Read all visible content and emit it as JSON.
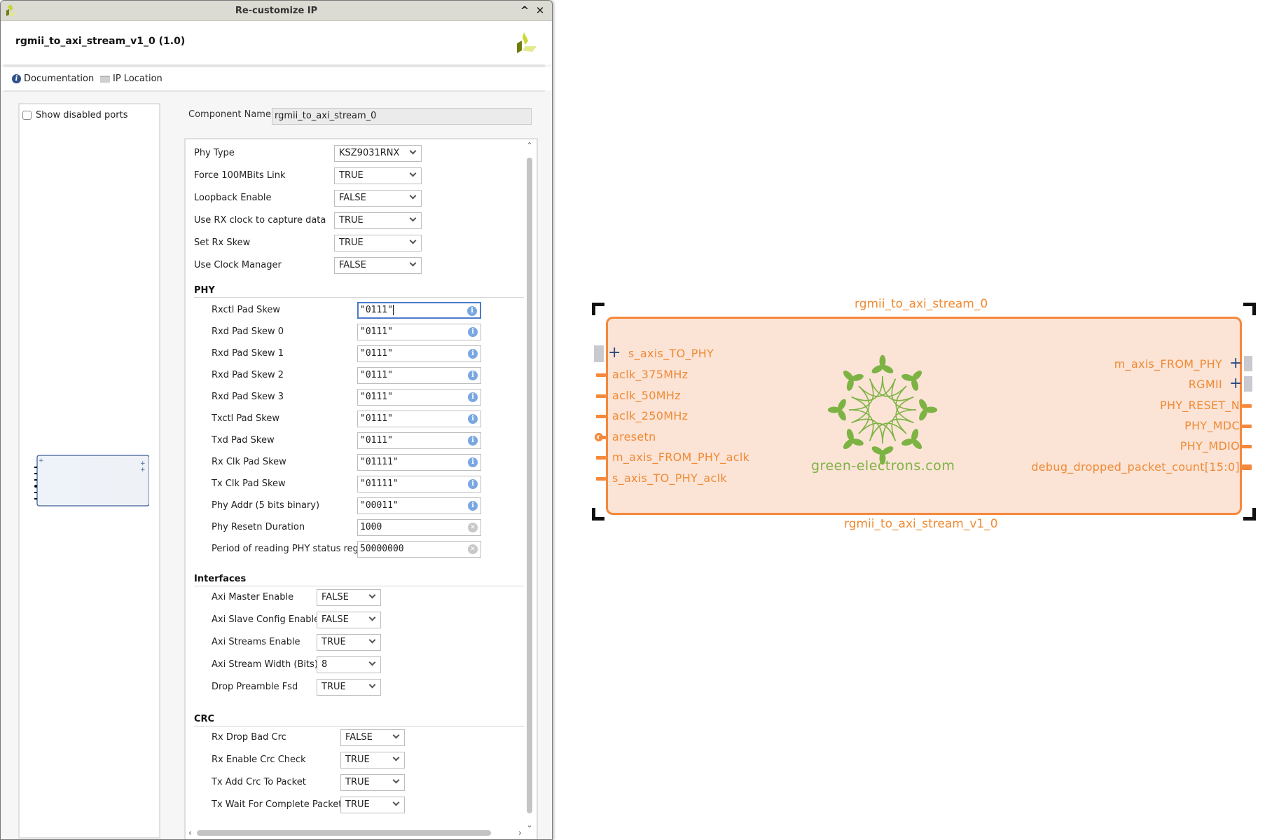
{
  "window": {
    "title": "Re-customize IP",
    "minimize_glyph": "^",
    "close_glyph": "✕"
  },
  "header": {
    "ip_title": "rgmii_to_axi_stream_v1_0 (1.0)",
    "logo_icon": "vendor-logo-icon"
  },
  "links": {
    "documentation": "Documentation",
    "ip_location": "IP Location"
  },
  "left_panel": {
    "show_disabled_ports": "Show disabled ports",
    "show_disabled_ports_checked": false
  },
  "component": {
    "label": "Component Name",
    "value": "rgmii_to_axi_stream_0"
  },
  "params": {
    "general": [
      {
        "label": "Phy Type",
        "value": "KSZ9031RNX"
      },
      {
        "label": "Force 100MBits Link",
        "value": "TRUE"
      },
      {
        "label": "Loopback Enable",
        "value": "FALSE"
      },
      {
        "label": "Use RX clock to capture data",
        "value": "TRUE"
      },
      {
        "label": "Set Rx Skew",
        "value": "TRUE"
      },
      {
        "label": "Use Clock Manager",
        "value": "FALSE"
      }
    ],
    "phy_title": "PHY",
    "phy": [
      {
        "label": "Rxctl Pad Skew",
        "value": "\"0111\"",
        "icon": "info"
      },
      {
        "label": "Rxd Pad Skew 0",
        "value": "\"0111\"",
        "icon": "info"
      },
      {
        "label": "Rxd Pad Skew 1",
        "value": "\"0111\"",
        "icon": "info"
      },
      {
        "label": "Rxd Pad Skew 2",
        "value": "\"0111\"",
        "icon": "info"
      },
      {
        "label": "Rxd Pad Skew 3",
        "value": "\"0111\"",
        "icon": "info"
      },
      {
        "label": "Txctl Pad Skew",
        "value": "\"0111\"",
        "icon": "info"
      },
      {
        "label": "Txd Pad Skew",
        "value": "\"0111\"",
        "icon": "info"
      },
      {
        "label": "Rx Clk Pad Skew",
        "value": "\"01111\"",
        "icon": "info"
      },
      {
        "label": "Tx Clk Pad Skew",
        "value": "\"01111\"",
        "icon": "info"
      },
      {
        "label": "Phy Addr (5 bits binary)",
        "value": "\"00011\"",
        "icon": "info"
      },
      {
        "label": "Phy Resetn Duration",
        "value": "1000",
        "icon": "clear"
      },
      {
        "label": "Period of reading PHY status registers",
        "value": "50000000",
        "icon": "clear"
      }
    ],
    "interfaces_title": "Interfaces",
    "interfaces": [
      {
        "label": "Axi Master Enable",
        "value": "FALSE"
      },
      {
        "label": "Axi Slave Config Enable",
        "value": "FALSE"
      },
      {
        "label": "Axi Streams Enable",
        "value": "TRUE"
      },
      {
        "label": "Axi Stream Width (Bits)",
        "value": "8"
      },
      {
        "label": "Drop Preamble Fsd",
        "value": "TRUE"
      }
    ],
    "crc_title": "CRC",
    "crc": [
      {
        "label": "Rx Drop Bad Crc",
        "value": "FALSE"
      },
      {
        "label": "Rx Enable Crc Check",
        "value": "TRUE"
      },
      {
        "label": "Tx Add Crc To Packet",
        "value": "TRUE"
      },
      {
        "label": "Tx Wait For Complete Packet",
        "value": "TRUE"
      }
    ]
  },
  "block": {
    "instance_name": "rgmii_to_axi_stream_0",
    "module_name": "rgmii_to_axi_stream_v1_0",
    "logo_text": "green-electrons.com",
    "colors": {
      "border": "#f5883a",
      "fill": "#fbe3d6",
      "text": "#f08a33",
      "logo": "#7db343"
    },
    "left_ports": [
      {
        "name": "s_axis_TO_PHY",
        "kind": "bus"
      },
      {
        "name": "aclk_375MHz",
        "kind": "pin"
      },
      {
        "name": "aclk_50MHz",
        "kind": "pin"
      },
      {
        "name": "aclk_250MHz",
        "kind": "pin"
      },
      {
        "name": "aresetn",
        "kind": "reset"
      },
      {
        "name": "m_axis_FROM_PHY_aclk",
        "kind": "pin"
      },
      {
        "name": "s_axis_TO_PHY_aclk",
        "kind": "pin"
      }
    ],
    "right_ports": [
      {
        "name": "m_axis_FROM_PHY",
        "kind": "bus"
      },
      {
        "name": "RGMII",
        "kind": "bus"
      },
      {
        "name": "PHY_RESET_N",
        "kind": "pin"
      },
      {
        "name": "PHY_MDC",
        "kind": "pin"
      },
      {
        "name": "PHY_MDIO",
        "kind": "pin"
      },
      {
        "name": "debug_dropped_packet_count[15:0]",
        "kind": "wide"
      }
    ]
  }
}
